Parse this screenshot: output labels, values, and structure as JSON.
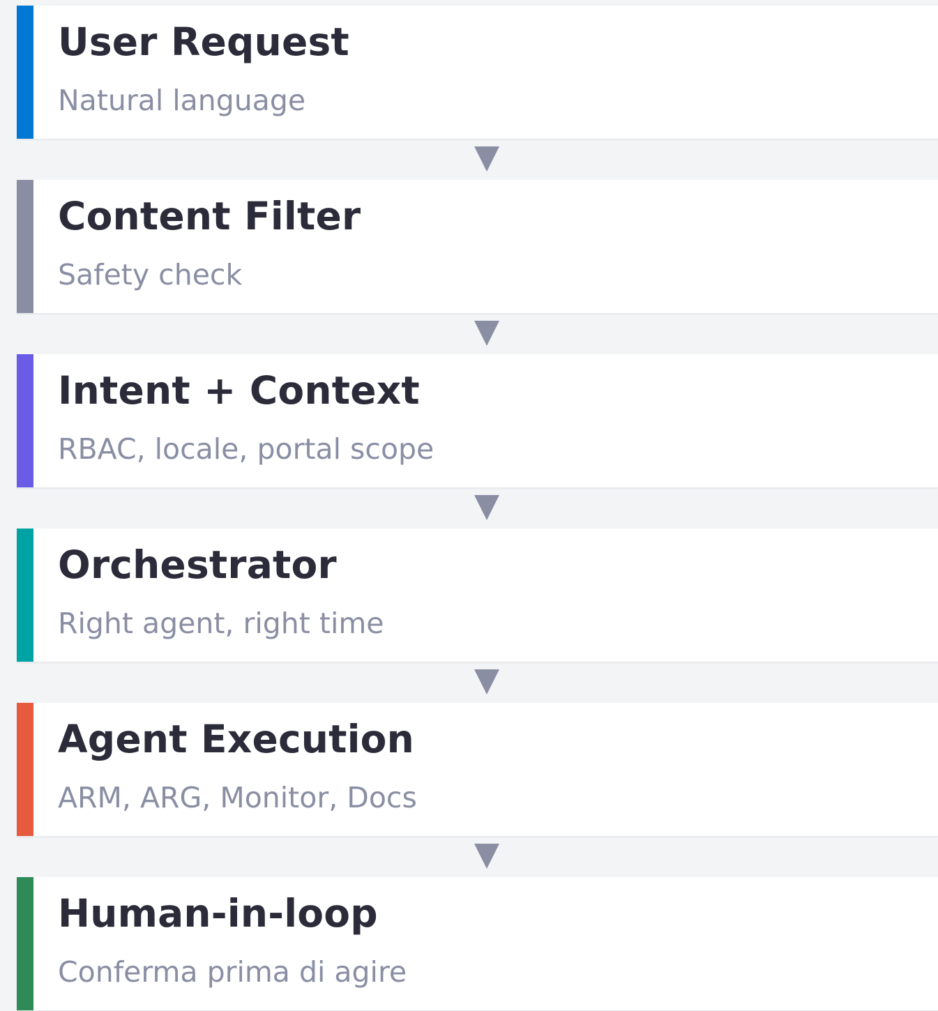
{
  "steps": [
    {
      "title": "User Request",
      "subtitle": "Natural language",
      "color": "#0078d4"
    },
    {
      "title": "Content Filter",
      "subtitle": "Safety check",
      "color": "#8a8ea3"
    },
    {
      "title": "Intent + Context",
      "subtitle": "RBAC, locale, portal scope",
      "color": "#6b5ce7"
    },
    {
      "title": "Orchestrator",
      "subtitle": "Right agent, right time",
      "color": "#00a3a3"
    },
    {
      "title": "Agent Execution",
      "subtitle": "ARM, ARG, Monitor, Docs",
      "color": "#e85a3e"
    },
    {
      "title": "Human-in-loop",
      "subtitle": "Conferma prima di agire",
      "color": "#2e8a57"
    }
  ],
  "connector_icon": "down-triangle-arrow",
  "connector_color": "#8a8ea3"
}
